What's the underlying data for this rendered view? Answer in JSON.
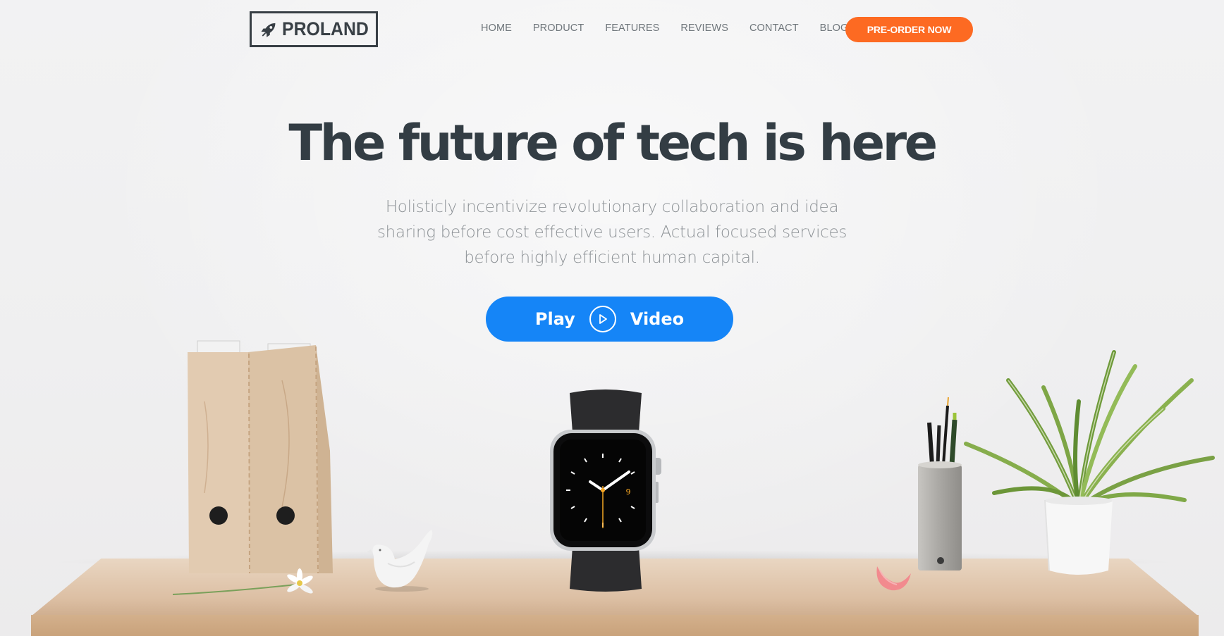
{
  "brand": {
    "logo_text": "PROLAND",
    "logo_icon": "rocket-icon"
  },
  "nav": {
    "links": [
      "HOME",
      "PRODUCT",
      "FEATURES",
      "REVIEWS",
      "CONTACT",
      "BLOG"
    ],
    "cta_label": "PRE-ORDER NOW"
  },
  "hero": {
    "title": "The future of tech is here",
    "subtitle": "Holisticly incentivize revolutionary collaboration and idea sharing before cost effective users. Actual focused services before highly efficient human capital.",
    "play_label_left": "Play",
    "play_label_right": "Video",
    "play_icon": "play-icon"
  },
  "watch": {
    "dial_number": "9"
  },
  "colors": {
    "accent_orange": "#fd6a22",
    "accent_blue": "#1585f7",
    "title_dark": "#333d44",
    "subtitle_gray": "#8d9296"
  }
}
